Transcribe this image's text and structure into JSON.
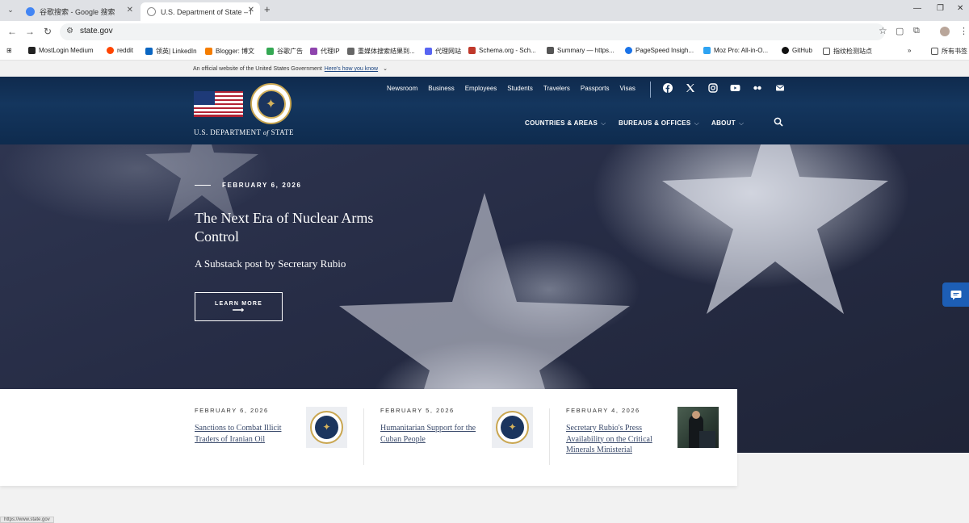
{
  "browser": {
    "tabs": [
      {
        "title": "谷歌搜索 - Google 搜索",
        "favicon_color": "#4285f4",
        "active": false
      },
      {
        "title": "U.S. Department of State – H",
        "favicon_color": "#888888",
        "active": true
      }
    ],
    "url": "state.gov",
    "bookmarks": [
      {
        "label": "MostLogin Medium",
        "color": "#222222"
      },
      {
        "label": "reddit",
        "color": "#ff4500"
      },
      {
        "label": "领英| LinkedIn",
        "color": "#0a66c2"
      },
      {
        "label": "Blogger: 博文",
        "color": "#f57d00"
      },
      {
        "label": "谷歌广告",
        "color": "#34a853"
      },
      {
        "label": "代理IP",
        "color": "#8e44ad"
      },
      {
        "label": "重媒体搜索结果到...",
        "color": "#666666"
      },
      {
        "label": "代理网站",
        "color": "#5865f2"
      },
      {
        "label": "Schema.org - Sch...",
        "color": "#c0392b"
      },
      {
        "label": "Summary — https...",
        "color": "#555555"
      },
      {
        "label": "PageSpeed Insigh...",
        "color": "#1a73e8"
      },
      {
        "label": "Moz Pro: All-in-O...",
        "color": "#2ea3f2"
      },
      {
        "label": "GitHub",
        "color": "#111111"
      },
      {
        "label": "指纹检测站点",
        "color": "#555555"
      }
    ],
    "all_bookmarks_label": "所有书签",
    "status_url": "https://www.state.gov"
  },
  "official_banner": {
    "text": "An official website of the United States Government",
    "link": "Here's how you know"
  },
  "header": {
    "dept_name_1": "U.S. DEPARTMENT",
    "dept_name_of": "of",
    "dept_name_2": "STATE",
    "top_links": [
      "Newsroom",
      "Business",
      "Employees",
      "Students",
      "Travelers",
      "Passports",
      "Visas"
    ],
    "main_nav": [
      {
        "label": "COUNTRIES & AREAS"
      },
      {
        "label": "BUREAUS & OFFICES"
      },
      {
        "label": "ABOUT"
      }
    ]
  },
  "hero": {
    "date": "FEBRUARY 6, 2026",
    "title": "The Next Era of Nuclear Arms Control",
    "subtitle": "A Substack post by Secretary Rubio",
    "button": "LEARN MORE"
  },
  "news": [
    {
      "date": "FEBRUARY 6, 2026",
      "title": "Sanctions to Combat Illicit Traders of Iranian Oil",
      "thumb": "seal"
    },
    {
      "date": "FEBRUARY 5, 2026",
      "title": "Humanitarian Support for the Cuban People",
      "thumb": "seal"
    },
    {
      "date": "FEBRUARY 4, 2026",
      "title": "Secretary Rubio's Press Availability on the Critical Minerals Ministerial",
      "thumb": "photo"
    }
  ],
  "colors": {
    "header_navy": "#14365e",
    "link_blue": "#1a4480",
    "seal_gold": "#c9a650"
  }
}
